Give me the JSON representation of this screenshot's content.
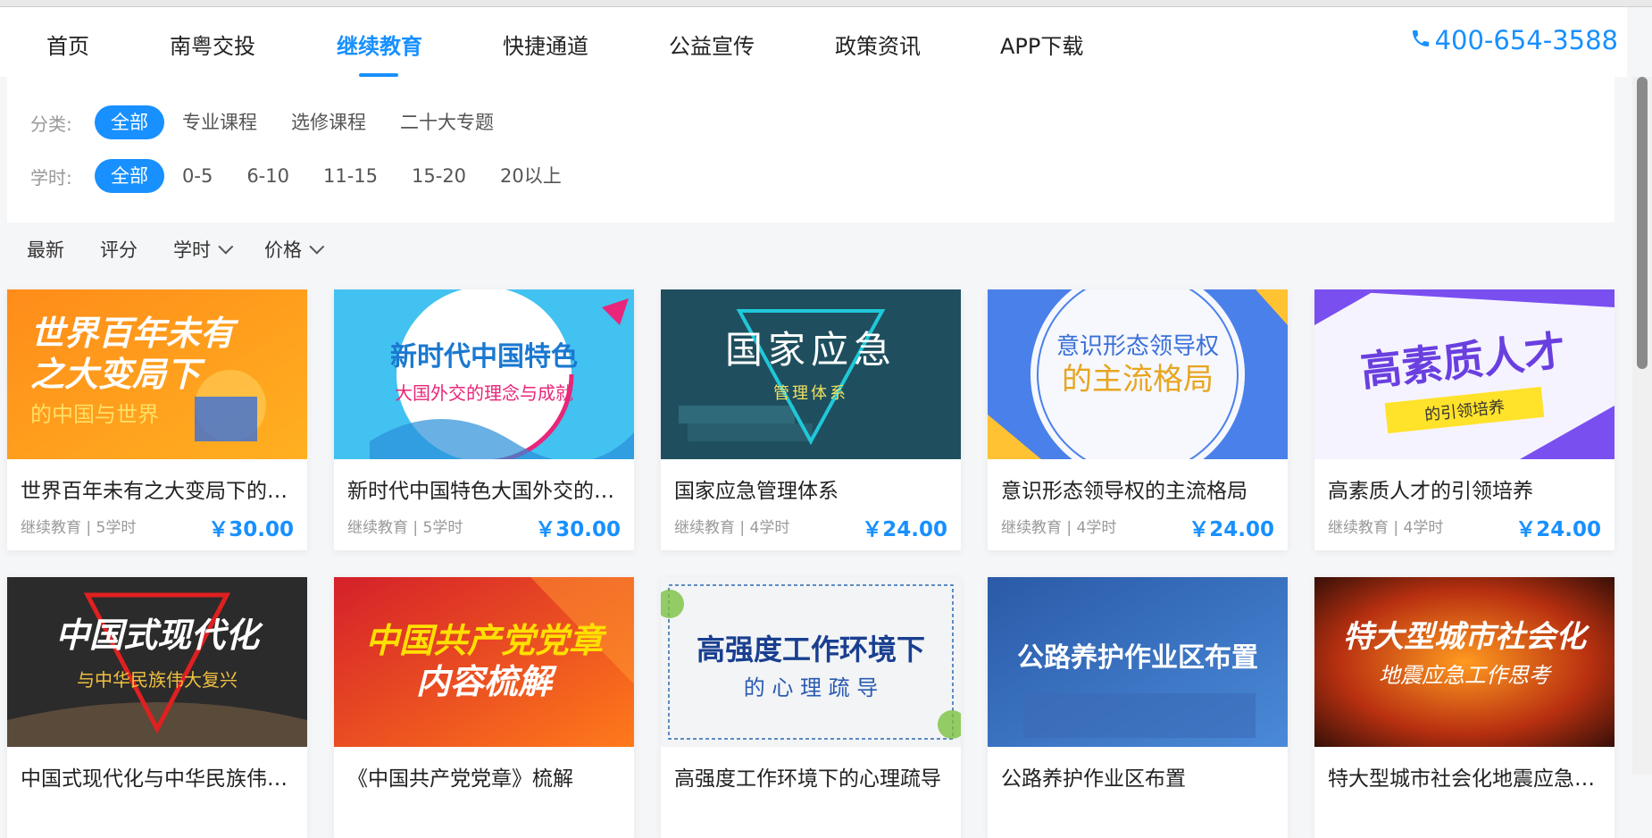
{
  "nav": {
    "items": [
      "首页",
      "南粤交投",
      "继续教育",
      "快捷通道",
      "公益宣传",
      "政策资讯",
      "APP下载"
    ],
    "active_index": 2,
    "phone": "400-654-3588"
  },
  "filters": {
    "category": {
      "label": "分类:",
      "options": [
        "全部",
        "专业课程",
        "选修课程",
        "二十大专题"
      ],
      "selected": "全部"
    },
    "hours": {
      "label": "学时:",
      "options": [
        "全部",
        "0-5",
        "6-10",
        "11-15",
        "15-20",
        "20以上"
      ],
      "selected": "全部"
    }
  },
  "sort": {
    "latest": "最新",
    "rating": "评分",
    "hours": "学时",
    "price": "价格"
  },
  "courses": [
    {
      "title": "世界百年未有之大变局下的中国与世界",
      "meta": "继续教育 | 5学时",
      "price": "￥30.00",
      "banner": {
        "line1": "世界百年未有",
        "line2": "之大变局下",
        "line3": "的中国与世界"
      }
    },
    {
      "title": "新时代中国特色大国外交的理念与成就",
      "meta": "继续教育 | 5学时",
      "price": "￥30.00",
      "banner": {
        "line1": "新时代中国特色",
        "line2": "大国外交的理念与成就"
      }
    },
    {
      "title": "国家应急管理体系",
      "meta": "继续教育 | 4学时",
      "price": "￥24.00",
      "banner": {
        "line1": "国家应急",
        "line2": "管理体系"
      }
    },
    {
      "title": "意识形态领导权的主流格局",
      "meta": "继续教育 | 4学时",
      "price": "￥24.00",
      "banner": {
        "line1": "意识形态领导权",
        "line2": "的主流格局"
      }
    },
    {
      "title": "高素质人才的引领培养",
      "meta": "继续教育 | 4学时",
      "price": "￥24.00",
      "banner": {
        "line1": "高素质人才",
        "line2": "的引领培养"
      }
    },
    {
      "title": "中国式现代化与中华民族伟大复兴",
      "meta": "",
      "price": "",
      "banner": {
        "line1": "中国式现代化",
        "line2": "与中华民族伟大复兴"
      }
    },
    {
      "title": "《中国共产党党章》梳解",
      "meta": "",
      "price": "",
      "banner": {
        "line1": "中国共产党党章",
        "line2": "内容梳解"
      }
    },
    {
      "title": "高强度工作环境下的心理疏导",
      "meta": "",
      "price": "",
      "banner": {
        "line1": "高强度工作环境下",
        "line2": "的 心 理 疏 导"
      }
    },
    {
      "title": "公路养护作业区布置",
      "meta": "",
      "price": "",
      "banner": {
        "line1": "公路养护作业区布置"
      }
    },
    {
      "title": "特大型城市社会化地震应急工作思考",
      "meta": "",
      "price": "",
      "banner": {
        "line1": "特大型城市社会化",
        "line2": "地震应急工作思考"
      }
    }
  ],
  "colors": {
    "accent": "#1890ff"
  }
}
